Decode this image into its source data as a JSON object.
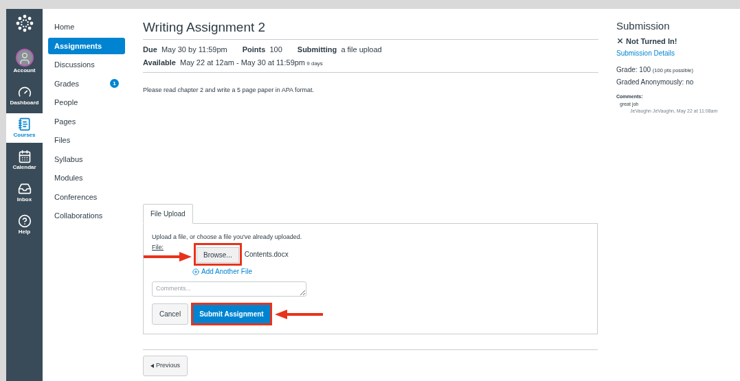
{
  "global_nav": [
    {
      "kind": "account",
      "label": "Account",
      "selected": false
    },
    {
      "kind": "dashboard",
      "label": "Dashboard",
      "selected": false
    },
    {
      "kind": "courses",
      "label": "Courses",
      "selected": true
    },
    {
      "kind": "calendar",
      "label": "Calendar",
      "selected": false
    },
    {
      "kind": "inbox",
      "label": "Inbox",
      "selected": false
    },
    {
      "kind": "help",
      "label": "Help",
      "selected": false
    }
  ],
  "course_nav": [
    {
      "label": "Home",
      "selected": false
    },
    {
      "label": "Assignments",
      "selected": true
    },
    {
      "label": "Discussions",
      "selected": false
    },
    {
      "label": "Grades",
      "selected": false,
      "badge": "1"
    },
    {
      "label": "People",
      "selected": false
    },
    {
      "label": "Pages",
      "selected": false
    },
    {
      "label": "Files",
      "selected": false
    },
    {
      "label": "Syllabus",
      "selected": false
    },
    {
      "label": "Modules",
      "selected": false
    },
    {
      "label": "Conferences",
      "selected": false
    },
    {
      "label": "Collaborations",
      "selected": false
    }
  ],
  "assignment": {
    "title": "Writing Assignment 2",
    "details": [
      [
        {
          "label": "Due",
          "value": "May 30 by 11:59pm"
        },
        {
          "label": "Points",
          "value": "100"
        },
        {
          "label": "Submitting",
          "value": "a file upload"
        }
      ],
      [
        {
          "label": "Available",
          "value": "May 22 at 12am - May 30 at 11:59pm",
          "note": "9 days"
        }
      ]
    ],
    "description": "Please read chapter 2 and write a 5 page paper in APA format."
  },
  "upload": {
    "tab": {
      "label": "File Upload",
      "selected": true
    },
    "instructions": "Upload a file, or choose a file you've already uploaded.",
    "file_label": "File:",
    "browse": "Browse...",
    "file_name": "Contents.docx",
    "add_file": "Add Another File",
    "comments_placeholder": "Comments...",
    "cancel": "Cancel",
    "submit": "Submit Assignment"
  },
  "previous": "Previous",
  "submission": {
    "title": "Submission",
    "status": "Not Turned In!",
    "details_link": "Submission Details",
    "grade_label": "Grade: 100",
    "grade_note": "(100 pts possible)",
    "anonymous": "Graded Anonymously: no",
    "comments_label": "Comments:",
    "comment": "great job",
    "comment_meta": "JeVaughn JeVaughn, May 22 at 11:08am"
  }
}
